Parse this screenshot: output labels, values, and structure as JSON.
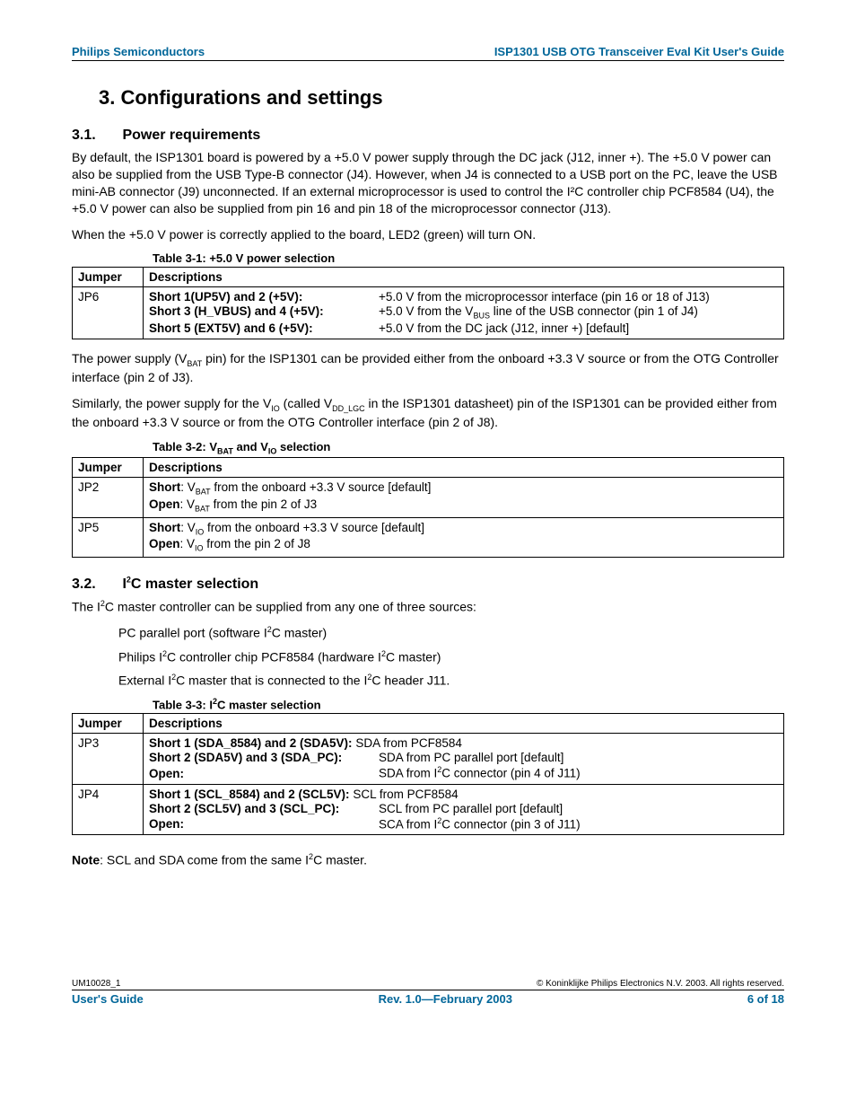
{
  "header": {
    "left": "Philips Semiconductors",
    "right": "ISP1301 USB OTG Transceiver Eval Kit User's Guide"
  },
  "section": {
    "number": "3.",
    "title": "Configurations and settings"
  },
  "s31": {
    "number": "3.1.",
    "title": "Power requirements",
    "p1": "By default, the ISP1301 board is powered by a +5.0 V power supply through the DC jack (J12, inner +). The +5.0 V power can also be supplied from the USB Type-B connector (J4). However, when J4 is connected to a USB port on the PC, leave the USB mini-AB connector (J9) unconnected. If an external microprocessor is used to control the I²C controller chip PCF8584 (U4), the +5.0 V power can also be supplied from pin 16 and pin 18 of the microprocessor connector (J13).",
    "p2": "When the +5.0 V power is correctly applied to the board, LED2 (green) will turn ON."
  },
  "table31": {
    "caption": "Table 3-1: +5.0 V power selection",
    "headers": [
      "Jumper",
      "Descriptions"
    ],
    "row_jumper": "JP6",
    "r1_label": "Short 1(UP5V) and 2 (+5V):",
    "r1_val": "+5.0 V from the microprocessor interface (pin 16 or 18 of J13)",
    "r2_label": "Short 3 (H_VBUS) and 4 (+5V):",
    "r2_val_a": "+5.0 V from the V",
    "r2_val_sub": "BUS",
    "r2_val_b": " line of the USB connector (pin 1 of J4)",
    "r3_label": "Short 5 (EXT5V) and 6 (+5V):",
    "r3_val": "+5.0 V from the DC jack (J12, inner +) [default]"
  },
  "mid": {
    "p1a": "The power supply (V",
    "p1sub": "BAT",
    "p1b": " pin) for the ISP1301 can be provided either from the onboard +3.3 V source or from the OTG Controller interface (pin 2 of J3).",
    "p2a": "Similarly, the power supply for the V",
    "p2sub1": "IO",
    "p2b": " (called V",
    "p2sub2": "DD_LGC",
    "p2c": " in the ISP1301 datasheet) pin of the ISP1301 can be provided either from the onboard +3.3 V source or from the OTG Controller interface (pin 2 of J8)."
  },
  "table32": {
    "caption_pre": "Table 3-2: V",
    "caption_sub1": "BAT",
    "caption_mid": " and V",
    "caption_sub2": "IO",
    "caption_post": " selection",
    "headers": [
      "Jumper",
      "Descriptions"
    ],
    "rows": [
      {
        "jumper": "JP2",
        "l1a": "Short",
        "l1b": ": V",
        "l1sub": "BAT",
        "l1c": " from the onboard +3.3 V source [default]",
        "l2a": "Open",
        "l2b": ": V",
        "l2sub": "BAT",
        "l2c": " from the pin 2 of J3"
      },
      {
        "jumper": "JP5",
        "l1a": "Short",
        "l1b": ": V",
        "l1sub": "IO",
        "l1c": " from the onboard +3.3 V source [default]",
        "l2a": "Open",
        "l2b": ": V",
        "l2sub": "IO",
        "l2c": " from the pin 2 of J8"
      }
    ]
  },
  "s32": {
    "number": "3.2.",
    "title_pre": "I",
    "title_post": "C master selection",
    "p1_pre": "The I",
    "p1_post": "C master controller can be supplied from any one of three sources:",
    "li1_pre": "PC parallel port (software I",
    "li1_post": "C master)",
    "li2_pre": "Philips I",
    "li2_mid": "C controller chip PCF8584 (hardware I",
    "li2_post": "C master)",
    "li3_pre": "External I",
    "li3_mid": "C master that is connected to the I",
    "li3_post": "C header J11."
  },
  "table33": {
    "caption_pre": "Table 3-3: I",
    "caption_post": "C master selection",
    "headers": [
      "Jumper",
      "Descriptions"
    ],
    "r1_jumper": "JP3",
    "r1_l1_label": "Short 1 (SDA_8584) and 2 (SDA5V):",
    "r1_l1_val": " SDA from PCF8584",
    "r1_l2_label": "Short 2 (SDA5V) and 3 (SDA_PC):",
    "r1_l2_val": "SDA from PC parallel port [default]",
    "r1_l3_label": "Open:",
    "r1_l3_val_pre": "SDA from I",
    "r1_l3_val_post": "C connector (pin 4 of J11)",
    "r2_jumper": "JP4",
    "r2_l1_label": "Short 1 (SCL_8584) and 2 (SCL5V):",
    "r2_l1_val": " SCL from PCF8584",
    "r2_l2_label": "Short 2 (SCL5V) and 3 (SCL_PC):",
    "r2_l2_val": "SCL from PC parallel port [default]",
    "r2_l3_label": "Open:",
    "r2_l3_val_pre": "SCA from I",
    "r2_l3_val_post": "C connector (pin 3 of J11)"
  },
  "note": {
    "label": "Note",
    "text_pre": ": SCL and SDA come from the same I",
    "text_post": "C master."
  },
  "footer": {
    "top_left": "UM10028_1",
    "top_right": "© Koninklijke Philips Electronics N.V. 2003. All rights reserved.",
    "bottom_left": "User's Guide",
    "bottom_center": "Rev. 1.0—February 2003",
    "bottom_right": "6 of 18"
  }
}
